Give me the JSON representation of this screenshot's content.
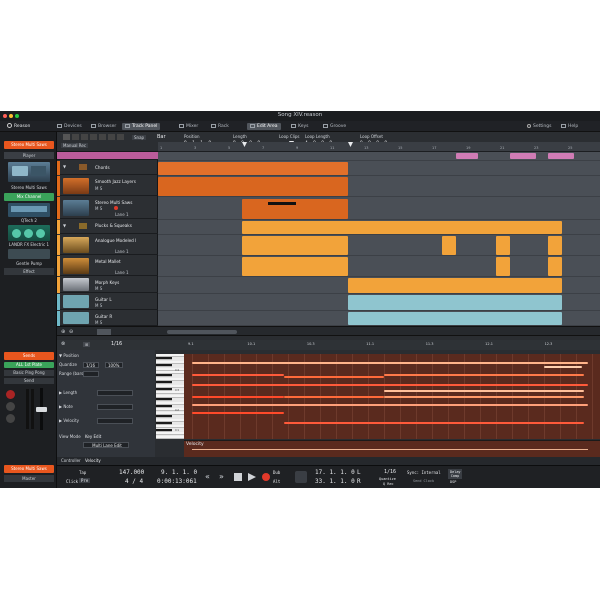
{
  "window": {
    "title": "Song XIV.reason",
    "colors": {
      "close": "#ff5f57",
      "min": "#febc2e",
      "max": "#28c840"
    }
  },
  "toolbar": {
    "app": "Reason",
    "items": [
      "Devices",
      "Browser",
      "Track Panel",
      "Mixer",
      "Rack",
      "Edit Area",
      "Keys",
      "Groove",
      "Settings",
      "Help"
    ]
  },
  "left": {
    "header1": "Stereo Multi Saws",
    "player": "Player",
    "device1": "Stereo Multi Saws",
    "mix_channel": "Mix Channel",
    "device2": "QTech 2",
    "device3": "LANDR FX Electric 1",
    "device4": "Gentle Pump",
    "effect": "Effect",
    "sends": "Sends",
    "send1": "ALL 1st Plate",
    "send2": "Basic Ping Pong",
    "send_btn": "Send",
    "bottom": "Stereo Multi Saws",
    "master": "Master"
  },
  "arrangement": {
    "snap_label": "Snap",
    "snap_value": "Bar",
    "manual_rec": "Manual Rec",
    "position_label": "Position",
    "position_value": "9. 1. 1. 0",
    "length_label": "Length",
    "length_value": "8. 0. 0. 0",
    "loopclips_label": "Loop Clips",
    "looplength_label": "Loop Length",
    "looplength_value": "4. 0. 0. 0",
    "loopoffset_label": "Loop Offset",
    "loopoffset_value": "0. 0. 0. 0",
    "ruler_ticks": [
      "1",
      "3",
      "5",
      "7",
      "9",
      "11",
      "13",
      "15",
      "17",
      "19",
      "21",
      "23",
      "25"
    ],
    "tracks": [
      {
        "name": "Chords",
        "type": "folder"
      },
      {
        "name": "Smooth Jazz Layers",
        "sub": "M S"
      },
      {
        "name": "Stereo Multi Saws",
        "sub": "Lane 1"
      },
      {
        "name": "Plucks & Squeaks",
        "type": "folder"
      },
      {
        "name": "Analogue Modeled I",
        "sub": "Lane 1"
      },
      {
        "name": "Metal Mallet",
        "sub": "Lane 1"
      },
      {
        "name": "Morph Keys",
        "sub": "M S"
      },
      {
        "name": "Guitar L",
        "sub": "M S"
      },
      {
        "name": "Guitar R",
        "sub": "M S"
      }
    ]
  },
  "editor": {
    "quantize_label": "Quantize",
    "quantize_value": "1/16",
    "quantize_pct": "100%",
    "range_label": "Range (bars)",
    "section_position": "Position",
    "section_length": "Length",
    "section_note": "Note",
    "section_velocity": "Velocity",
    "view_mode_label": "View Mode",
    "view_mode_value": "Key Edit",
    "multi_lane": "Multi Lane Edit",
    "controller_label": "Controller",
    "controller_value": "Velocity",
    "velocity_lane": "Velocity",
    "grid_value": "1/16",
    "ruler": [
      "9.1",
      "10.1",
      "10.3",
      "11.1",
      "11.3",
      "12.1",
      "12.3"
    ],
    "key_labels": [
      "C4",
      "C3",
      "C2",
      "C1"
    ]
  },
  "transport": {
    "tap": "Tap",
    "click": "Click",
    "pre": "Pre",
    "tempo": "147.000",
    "signature": "4 / 4",
    "pos1": "9. 1. 1. 0",
    "time": "0:00:13:061",
    "loop_start": "17. 1. 1. 0",
    "loop_end": "33. 1. 1. 0",
    "l": "L",
    "r": "R",
    "dub": "Dub",
    "alt": "Alt",
    "quantize_value": "1/16",
    "quantize_label": "Quantize",
    "q_rec": "Q Rec",
    "sync_label": "Sync: Internal",
    "send_clock": "Send Clock",
    "delay_comp": "Delay Comp",
    "dsp": "DSP"
  }
}
